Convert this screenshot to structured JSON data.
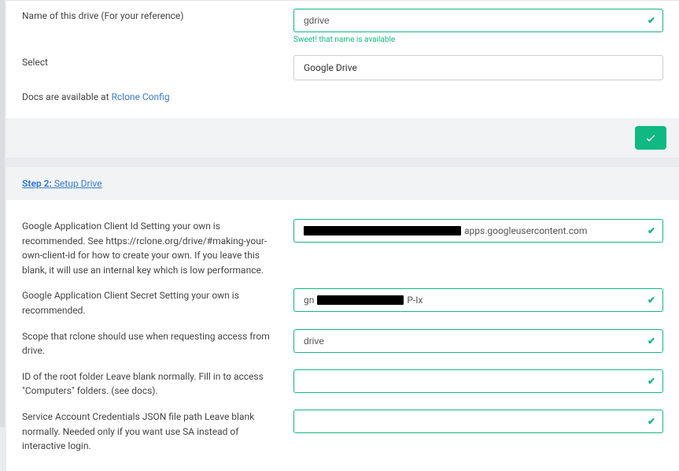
{
  "step1": {
    "name_label": "Name of this drive (For your reference)",
    "name_value": "gdrive",
    "name_helper": "Sweet! that name is available",
    "select_label": "Select",
    "select_value": "Google Drive",
    "docs_prefix": "Docs are available at ",
    "docs_link_text": "Rclone Config"
  },
  "step2": {
    "title_num": "Step 2:",
    "title_rest": " Setup Drive",
    "client_id_label": "Google Application Client Id Setting your own is recommended. See https://rclone.org/drive/#making-your-own-client-id for how to create your own. If you leave this blank, it will use an internal key which is low performance.",
    "client_id_suffix": "apps.googleusercontent.com",
    "client_secret_label": "Google Application Client Secret Setting your own is recommended.",
    "client_secret_prefix": "gn",
    "client_secret_suffix": "P-Ix",
    "scope_label": "Scope that rclone should use when requesting access from drive.",
    "scope_value": "drive",
    "root_folder_label": "ID of the root folder Leave blank normally. Fill in to access \"Computers\" folders. (see docs).",
    "root_folder_value": "",
    "sa_label": "Service Account Credentials JSON file path Leave blank normally. Needed only if you want use SA instead of interactive login.",
    "sa_value": ""
  }
}
